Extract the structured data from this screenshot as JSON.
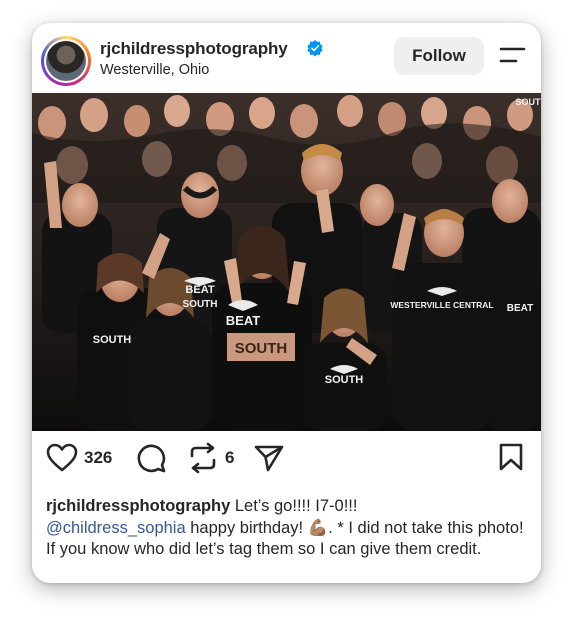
{
  "post": {
    "username": "rjchildressphotography",
    "location": "Westerville, Ohio",
    "follow_label": "Follow",
    "image_texts": [
      "BEAT",
      "SOUTH",
      "BEAT",
      "SOUTH",
      "WESTERVILLE CENTRAL",
      "SOUTH",
      "SOUTH",
      "BEAT",
      "SOUT"
    ],
    "likes": "326",
    "reposts": "6",
    "caption_user": "rjchildressphotography",
    "caption_line1_text": " Let’s go!!!! I7-0!!!",
    "caption_mention": "@childress_sophia",
    "caption_mid_text": " happy birthday! ",
    "caption_emoji": "💪🏽",
    "caption_tail": ". * I did not take this photo! If you know who did let’s tag them so I can give them credit."
  },
  "icons": {
    "verified": "verified-badge-icon",
    "menu": "menu-icon",
    "like": "heart-icon",
    "comment": "comment-icon",
    "repost": "repost-icon",
    "share": "share-icon",
    "save": "bookmark-icon"
  },
  "colors": {
    "verified_blue": "#0095f6",
    "text": "#262626",
    "mention": "#385898",
    "follow_bg": "#efefef"
  }
}
